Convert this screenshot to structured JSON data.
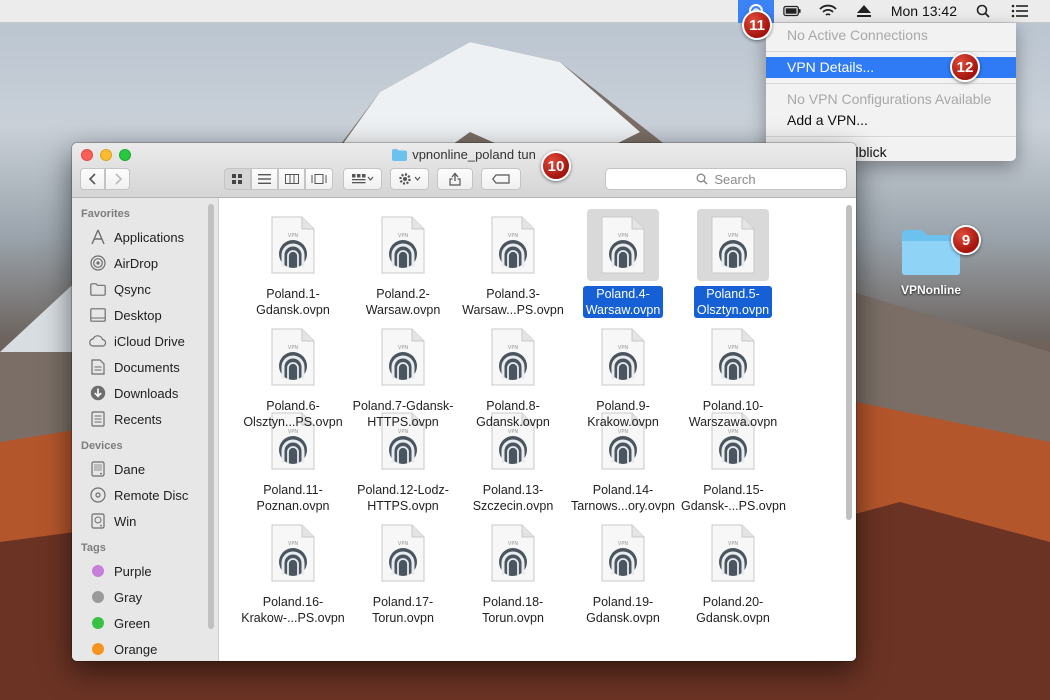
{
  "menubar": {
    "clock": "Mon 13:42",
    "icons": [
      "tunnelblick-icon",
      "battery-icon",
      "wifi-icon",
      "eject-icon",
      "search-icon",
      "list-icon"
    ]
  },
  "dropdown": {
    "items": [
      {
        "label": "No Active Connections",
        "disabled": true
      },
      {
        "label": "VPN Details...",
        "selected": true
      },
      {
        "label": "No VPN Configurations Available",
        "disabled": true
      },
      {
        "label": "Add a VPN..."
      },
      {
        "label": "Quit Tunnelblick"
      }
    ]
  },
  "badges": [
    "9",
    "10",
    "11",
    "12"
  ],
  "desktop_folder": {
    "label": "VPNonline"
  },
  "window": {
    "title": "vpnonline_poland tun",
    "search_placeholder": "Search"
  },
  "sidebar": {
    "favorites_header": "Favorites",
    "favorites": [
      "Applications",
      "AirDrop",
      "Qsync",
      "Desktop",
      "iCloud Drive",
      "Documents",
      "Downloads",
      "Recents"
    ],
    "devices_header": "Devices",
    "devices": [
      "Dane",
      "Remote Disc",
      "Win"
    ],
    "tags_header": "Tags",
    "tags": [
      {
        "label": "Purple",
        "color": "#c77fdb"
      },
      {
        "label": "Gray",
        "color": "#9a9a9a"
      },
      {
        "label": "Green",
        "color": "#39c145"
      },
      {
        "label": "Orange",
        "color": "#f6941f"
      }
    ]
  },
  "files": [
    {
      "l1": "Poland.1-",
      "l2": "Gdansk.ovpn"
    },
    {
      "l1": "Poland.2-",
      "l2": "Warsaw.ovpn"
    },
    {
      "l1": "Poland.3-",
      "l2": "Warsaw...PS.ovpn"
    },
    {
      "l1": "Poland.4-",
      "l2": "Warsaw.ovpn",
      "selected": true
    },
    {
      "l1": "Poland.5-",
      "l2": "Olsztyn.ovpn",
      "selected": true
    },
    {
      "l1": "Poland.6-",
      "l2": "Olsztyn...PS.ovpn"
    },
    {
      "l1": "Poland.7-Gdansk-",
      "l2": "HTTPS.ovpn"
    },
    {
      "l1": "Poland.8-",
      "l2": "Gdansk.ovpn"
    },
    {
      "l1": "Poland.9-",
      "l2": "Krakow.ovpn"
    },
    {
      "l1": "Poland.10-",
      "l2": "Warszawa.ovpn"
    },
    {
      "l1": "Poland.11-",
      "l2": "Poznan.ovpn"
    },
    {
      "l1": "Poland.12-Lodz-",
      "l2": "HTTPS.ovpn"
    },
    {
      "l1": "Poland.13-",
      "l2": "Szczecin.ovpn"
    },
    {
      "l1": "Poland.14-",
      "l2": "Tarnows...ory.ovpn"
    },
    {
      "l1": "Poland.15-",
      "l2": "Gdansk-...PS.ovpn"
    },
    {
      "l1": "Poland.16-",
      "l2": "Krakow-...PS.ovpn"
    },
    {
      "l1": "Poland.17-",
      "l2": "Torun.ovpn"
    },
    {
      "l1": "Poland.18-",
      "l2": "Torun.ovpn"
    },
    {
      "l1": "Poland.19-",
      "l2": "Gdansk.ovpn"
    },
    {
      "l1": "Poland.20-",
      "l2": "Gdansk.ovpn"
    }
  ]
}
